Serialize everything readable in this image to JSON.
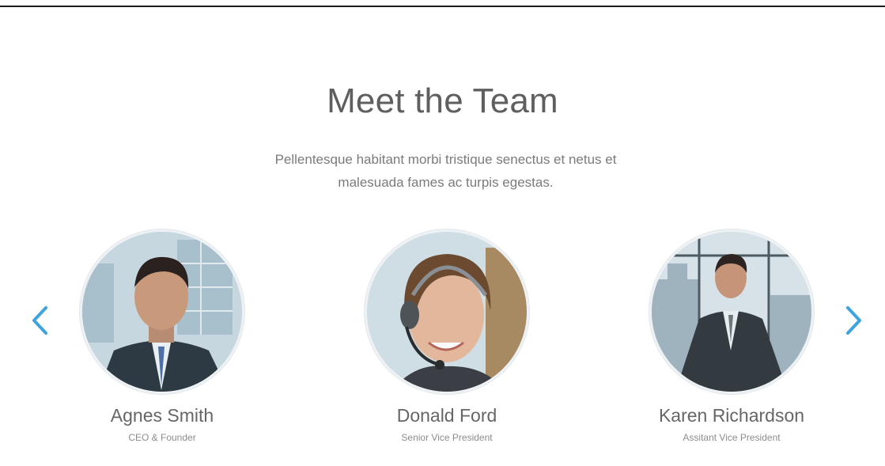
{
  "section": {
    "title": "Meet the Team",
    "intro_line1": "Pellentesque habitant morbi tristique senectus et netus et",
    "intro_line2": "malesuada fames ac turpis egestas."
  },
  "carousel": {
    "prev_icon": "chevron-left-icon",
    "next_icon": "chevron-right-icon",
    "accent_color": "#3fa3e0"
  },
  "members": [
    {
      "name": "Agnes Smith",
      "role": "CEO & Founder"
    },
    {
      "name": "Donald Ford",
      "role": "Senior Vice President"
    },
    {
      "name": "Karen Richardson",
      "role": "Assitant Vice President"
    }
  ]
}
